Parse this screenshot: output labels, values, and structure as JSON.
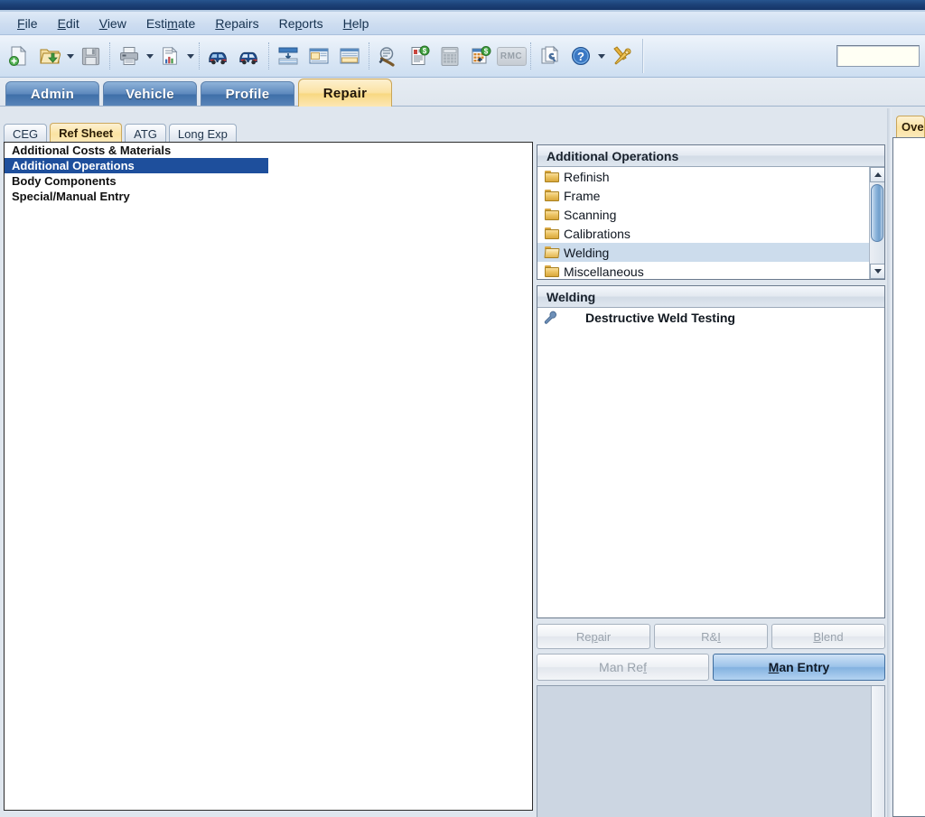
{
  "window": {
    "titlebar_color": "#1d4279"
  },
  "menubar": {
    "items": [
      {
        "pre": "",
        "acc": "F",
        "post": "ile"
      },
      {
        "pre": "",
        "acc": "E",
        "post": "dit"
      },
      {
        "pre": "",
        "acc": "V",
        "post": "iew"
      },
      {
        "pre": "Esti",
        "acc": "m",
        "post": "ate"
      },
      {
        "pre": "",
        "acc": "R",
        "post": "epairs"
      },
      {
        "pre": "Re",
        "acc": "p",
        "post": "orts"
      },
      {
        "pre": "",
        "acc": "H",
        "post": "elp"
      }
    ]
  },
  "toolbar": {
    "buttons": [
      {
        "name": "new-estimate-icon",
        "title": "New"
      },
      {
        "name": "open-folder-icon",
        "title": "Open"
      },
      {
        "name": "save-icon",
        "title": "Save"
      },
      {
        "name": "print-icon",
        "title": "Print"
      },
      {
        "name": "report-chart-icon",
        "title": "Reports"
      },
      {
        "name": "vehicle-left-icon",
        "title": "Vehicle Left"
      },
      {
        "name": "vehicle-right-icon",
        "title": "Vehicle Right"
      },
      {
        "name": "layout-split-icon",
        "title": "Split View"
      },
      {
        "name": "layout-top-icon",
        "title": "Top View"
      },
      {
        "name": "layout-bottom-icon",
        "title": "Bottom View"
      },
      {
        "name": "parts-search-icon",
        "title": "Parts Search"
      },
      {
        "name": "price-list-icon",
        "title": "Price List"
      },
      {
        "name": "calculator-icon",
        "title": "Calculator"
      },
      {
        "name": "calendar-price-icon",
        "title": "Calendar"
      },
      {
        "name": "rmc-icon",
        "title": "RMC"
      },
      {
        "name": "documents-icon",
        "title": "Documents"
      },
      {
        "name": "help-icon",
        "title": "Help"
      },
      {
        "name": "tools-icon",
        "title": "Tools"
      }
    ],
    "rmc_label": "RMC",
    "search_value": "",
    "search_placeholder": ""
  },
  "main_tabs": [
    {
      "label": "Admin",
      "active": false
    },
    {
      "label": "Vehicle",
      "active": false
    },
    {
      "label": "Profile",
      "active": false
    },
    {
      "label": "Repair",
      "active": true
    }
  ],
  "sub_tabs": [
    {
      "label": "CEG",
      "active": false
    },
    {
      "label": "Ref Sheet",
      "active": true
    },
    {
      "label": "ATG",
      "active": false
    },
    {
      "label": "Long Exp",
      "active": false
    }
  ],
  "tree": {
    "rows": [
      {
        "label": "Additional Costs & Materials",
        "selected": false
      },
      {
        "label": "Additional Operations",
        "selected": true
      },
      {
        "label": "Body Components",
        "selected": false
      },
      {
        "label": "Special/Manual Entry",
        "selected": false
      }
    ]
  },
  "operations_panel": {
    "title": "Additional Operations",
    "rows": [
      {
        "label": "Refinish",
        "selected": false,
        "open": false
      },
      {
        "label": "Frame",
        "selected": false,
        "open": false
      },
      {
        "label": "Scanning",
        "selected": false,
        "open": false
      },
      {
        "label": "Calibrations",
        "selected": false,
        "open": false
      },
      {
        "label": "Welding",
        "selected": true,
        "open": true
      },
      {
        "label": "Miscellaneous",
        "selected": false,
        "open": false
      }
    ]
  },
  "welding_panel": {
    "title": "Welding",
    "rows": [
      {
        "label": "Destructive Weld Testing",
        "icon": "wrench-icon"
      }
    ]
  },
  "action_buttons": {
    "row1": [
      {
        "pre": "Re",
        "acc": "p",
        "post": "air",
        "enabled": false
      },
      {
        "pre": "R&",
        "acc": "I",
        "post": "",
        "enabled": false
      },
      {
        "pre": "",
        "acc": "B",
        "post": "lend",
        "enabled": false
      }
    ],
    "row2": [
      {
        "pre": "Man Re",
        "acc": "f",
        "post": "",
        "enabled": false
      },
      {
        "pre": "",
        "acc": "M",
        "post": "an Entry",
        "enabled": true
      }
    ]
  },
  "edge_tab": {
    "label": "Ove"
  },
  "colors": {
    "selection_blue": "#1e4f9c",
    "active_tab_amber": "#fbe3a2",
    "panel_header": "#e3e9f1",
    "bottom_pane": "#ccd6e2"
  }
}
